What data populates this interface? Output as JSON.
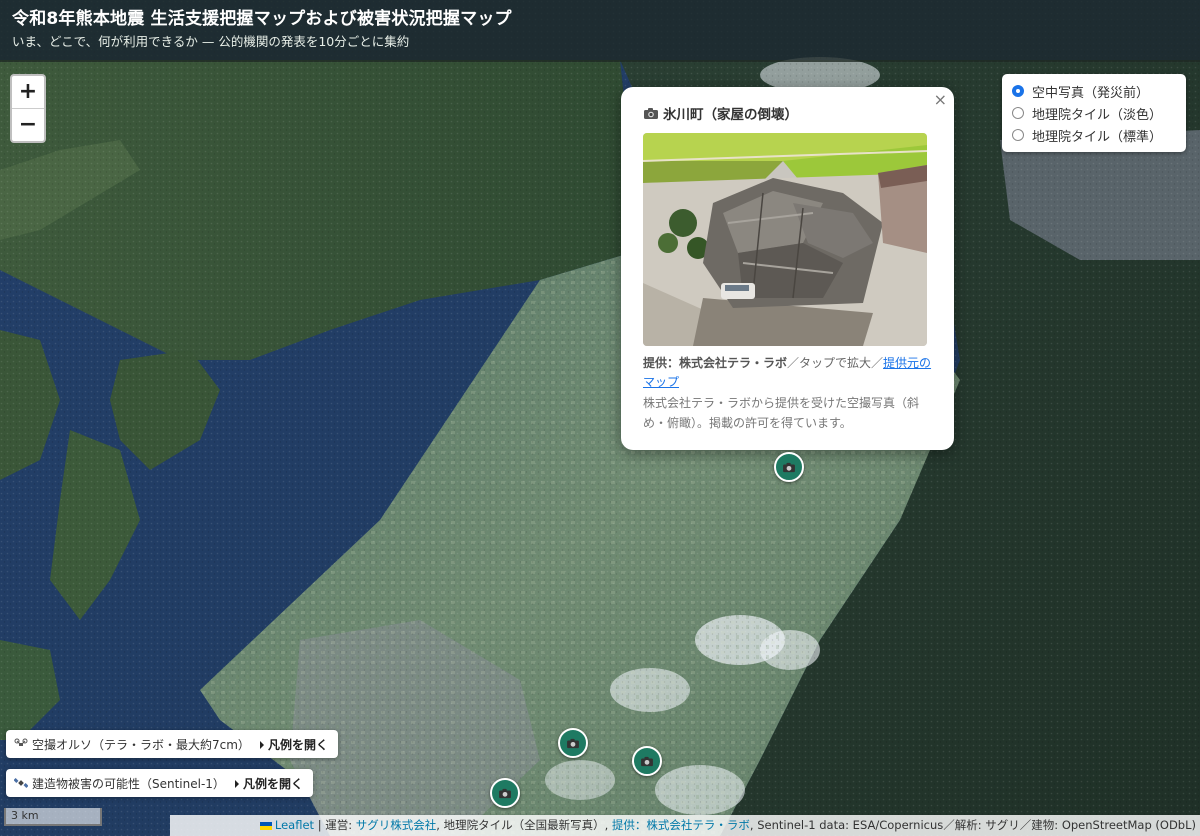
{
  "header": {
    "title": "令和8年熊本地震 生活支援把握マップおよび被害状況把握マップ",
    "subtitle": "いま、どこで、何が利用できるか — 公的機関の発表を10分ごとに集約"
  },
  "zoom": {
    "in_label": "+",
    "out_label": "−"
  },
  "layers": {
    "options": [
      {
        "label": "空中写真（発災前）",
        "selected": true
      },
      {
        "label": "地理院タイル（淡色）",
        "selected": false
      },
      {
        "label": "地理院タイル（標準）",
        "selected": false
      }
    ]
  },
  "popup": {
    "icon": "camera-icon",
    "title": "氷川町（家屋の倒壊）",
    "close_label": "×",
    "credit_label": "提供：株式会社テラ・ラボ",
    "credit_text": "／タップで拡大／",
    "credit_link": "提供元のマップ",
    "description": "株式会社テラ・ラボから提供を受けた空撮写真（斜め・俯瞰）。掲載の許可を得ています。"
  },
  "markers": [
    {
      "icon": "camera-icon",
      "place": "氷川町"
    },
    {
      "icon": "camera-icon"
    },
    {
      "icon": "camera-icon"
    },
    {
      "icon": "camera-icon"
    }
  ],
  "legends": [
    {
      "icon": "drone-icon",
      "label": "空撮オルソ（テラ・ラボ・最大約7cm）",
      "toggle": "凡例を開く"
    },
    {
      "icon": "satellite-icon",
      "label": "建造物被害の可能性（Sentinel-1）",
      "toggle": "凡例を開く"
    }
  ],
  "scale": {
    "label": "3 km"
  },
  "attribution": {
    "leaflet": "Leaflet",
    "sep1": " | 運営: ",
    "operator": "サグリ株式会社",
    "text2": ", 地理院タイル（全国最新写真）, ",
    "provider": "提供：株式会社テラ・ラボ",
    "text3": ", Sentinel-1 data: ESA/Copernicus／解析: サグリ／建物: OpenStreetMap (ODbL)"
  },
  "colors": {
    "marker": "#1e7a62",
    "accent": "#1a73e8",
    "header_bg": "#1e2822"
  }
}
